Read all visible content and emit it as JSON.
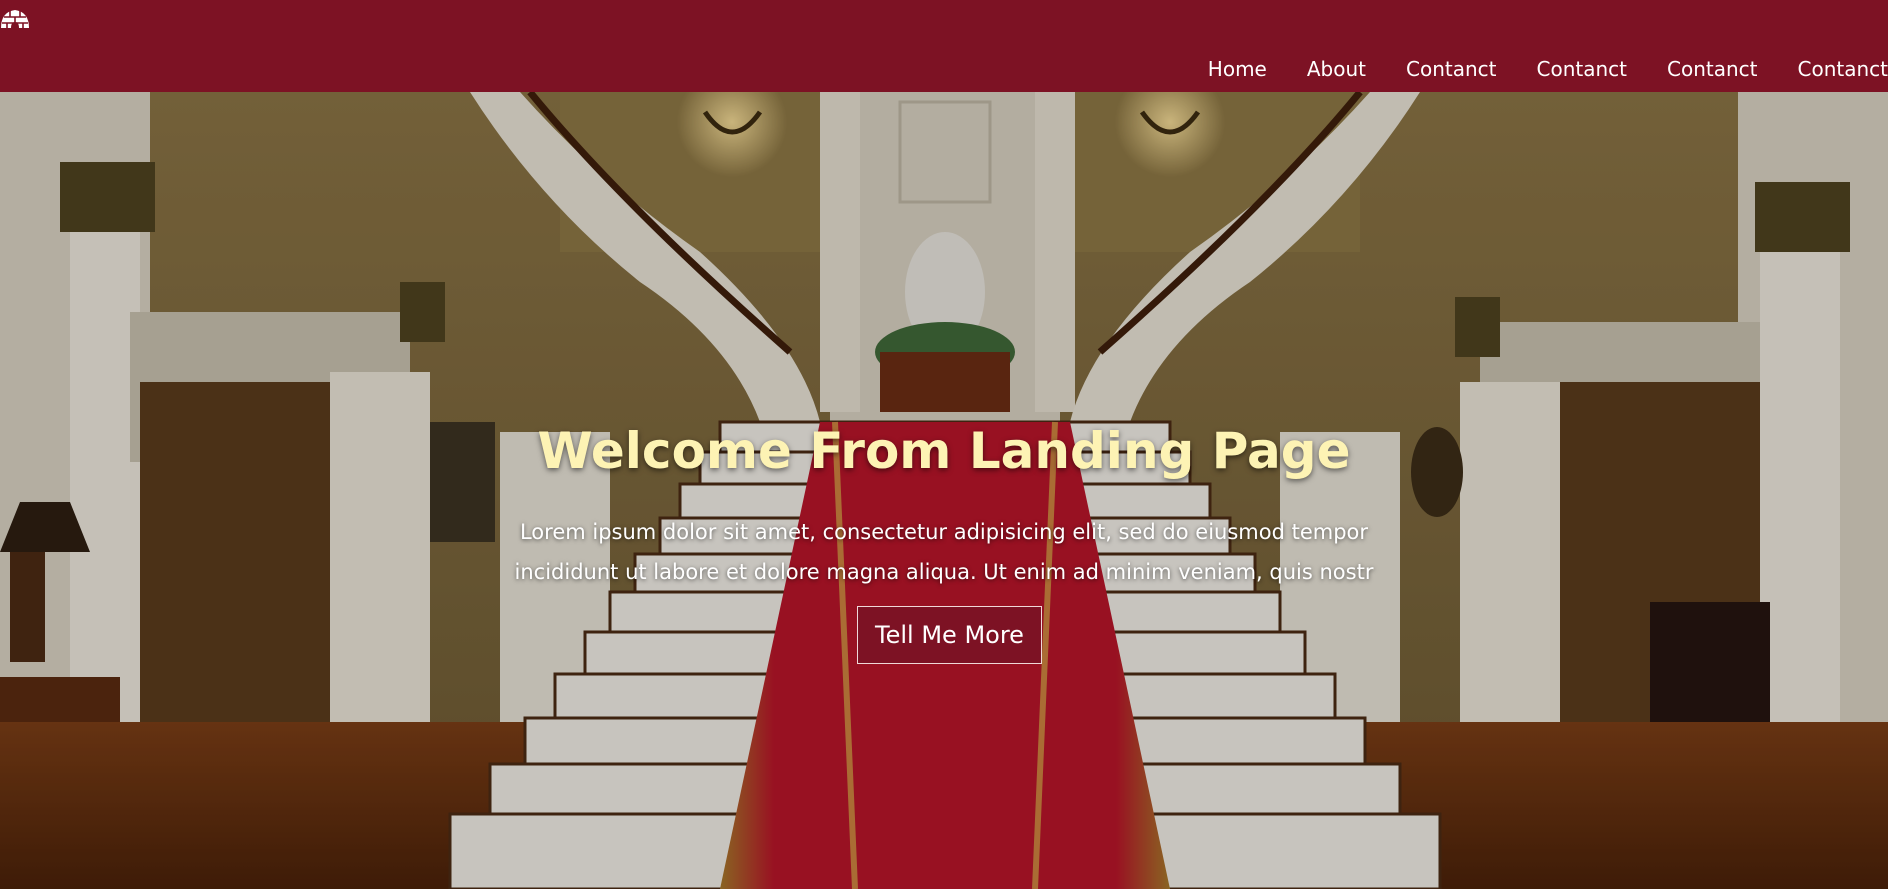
{
  "brand": {
    "logo_icon": "igloo-icon",
    "color": "#7d1224"
  },
  "nav": {
    "items": [
      {
        "label": "Home"
      },
      {
        "label": "About"
      },
      {
        "label": "Contanct"
      },
      {
        "label": "Contanct"
      },
      {
        "label": "Contanct"
      },
      {
        "label": "Contanct"
      }
    ]
  },
  "hero": {
    "title": "Welcome From Landing Page",
    "text_line1": "Lorem ipsum dolor sit amet, consectetur adipisicing elit, sed do eiusmod tempor",
    "text_line2": "incididunt ut labore et dolore magna aliqua. Ut enim ad minim veniam, quis nostr",
    "button_label": "Tell Me More",
    "background_image": "grand-staircase-hall",
    "title_color": "#fdf3b4"
  }
}
